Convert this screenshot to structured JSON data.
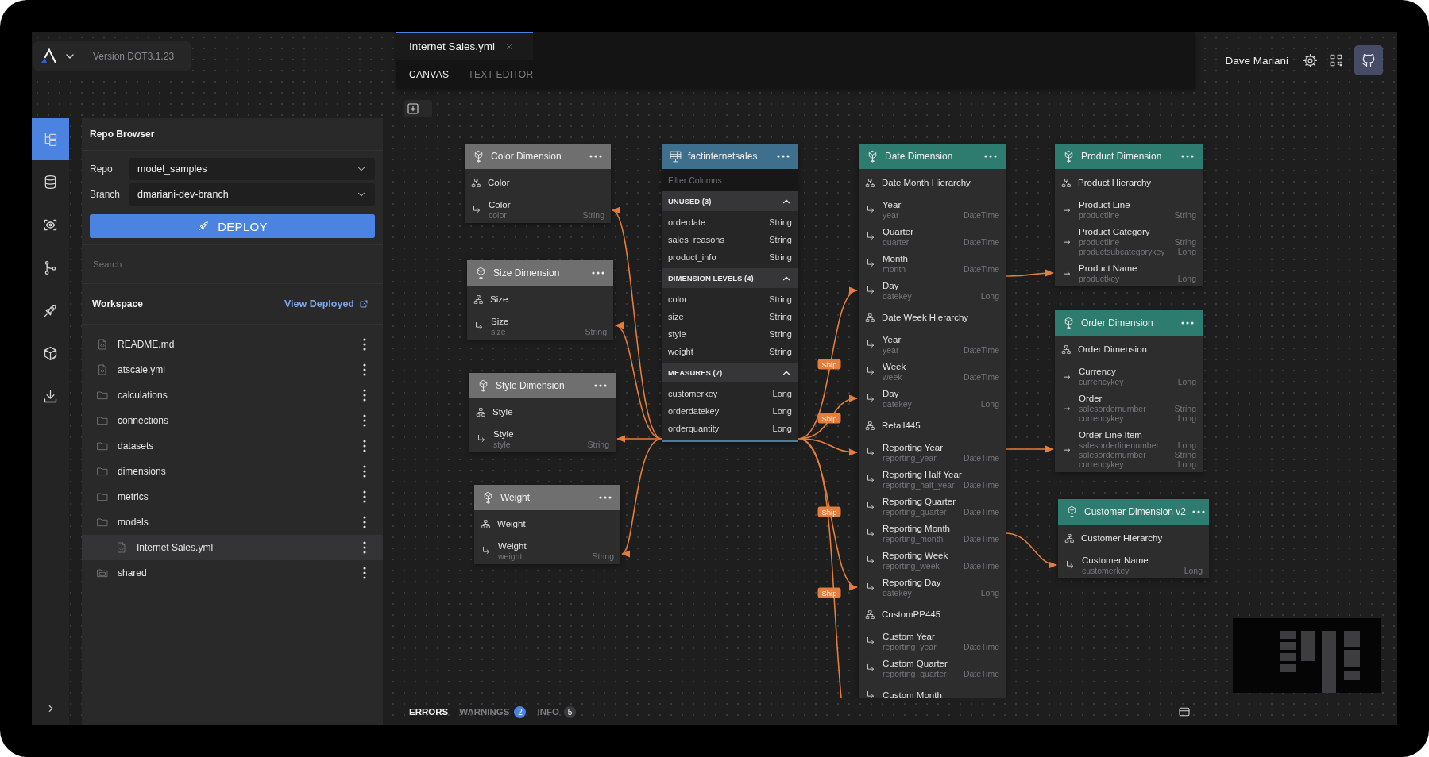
{
  "header": {
    "version": "Version DOT3.1.23"
  },
  "rail": [
    {
      "selected": true
    },
    {
      "selected": false
    },
    {
      "selected": false
    },
    {
      "selected": false
    },
    {
      "selected": false
    },
    {
      "selected": false
    },
    {
      "selected": false
    }
  ],
  "repo_browser": {
    "title": "Repo Browser",
    "fields": [
      {
        "label": "Repo",
        "value": "model_samples"
      },
      {
        "label": "Branch",
        "value": "dmariani-dev-branch"
      }
    ],
    "deploy_button": "DEPLOY",
    "search": {
      "placeholder": "Search"
    },
    "workspace": {
      "title": "Workspace",
      "link": "View Deployed"
    },
    "files": [
      {
        "name": "README.md",
        "kind": "file",
        "selected": false
      },
      {
        "name": "atscale.yml",
        "kind": "file",
        "selected": false
      },
      {
        "name": "calculations",
        "kind": "folder",
        "selected": false
      },
      {
        "name": "connections",
        "kind": "folder",
        "selected": false
      },
      {
        "name": "datasets",
        "kind": "folder",
        "selected": false
      },
      {
        "name": "dimensions",
        "kind": "folder",
        "selected": false
      },
      {
        "name": "metrics",
        "kind": "folder",
        "selected": false
      },
      {
        "name": "models",
        "kind": "folder",
        "selected": false,
        "children": [
          {
            "name": "Internet Sales.yml",
            "kind": "file",
            "selected": true
          }
        ]
      },
      {
        "name": "shared",
        "kind": "shared_folder",
        "selected": false
      }
    ]
  },
  "editor_tabs": [
    {
      "label": "Internet Sales.yml",
      "selected": true
    }
  ],
  "view_tabs": [
    {
      "label": "CANVAS",
      "selected": true
    },
    {
      "label": "TEXT EDITOR",
      "selected": false
    }
  ],
  "user": {
    "name": "Dave Mariani"
  },
  "canvas": {
    "nodes": [
      {
        "kind": "degenerate_dimension",
        "title": "Color Dimension",
        "rows": [
          {
            "kind": "hierarchy",
            "label": "Color"
          },
          {
            "kind": "level",
            "label": "Color",
            "columns": [
              {
                "name": "color",
                "type": "String"
              }
            ]
          }
        ]
      },
      {
        "kind": "degenerate_dimension",
        "title": "Size Dimension",
        "rows": [
          {
            "kind": "hierarchy",
            "label": "Size"
          },
          {
            "kind": "level",
            "label": "Size",
            "columns": [
              {
                "name": "size",
                "type": "String"
              }
            ]
          }
        ]
      },
      {
        "kind": "degenerate_dimension",
        "title": "Style Dimension",
        "rows": [
          {
            "kind": "hierarchy",
            "label": "Style"
          },
          {
            "kind": "level",
            "label": "Style",
            "columns": [
              {
                "name": "style",
                "type": "String"
              }
            ]
          }
        ]
      },
      {
        "kind": "degenerate_dimension",
        "title": "Weight",
        "rows": [
          {
            "kind": "hierarchy",
            "label": "Weight"
          },
          {
            "kind": "level",
            "label": "Weight",
            "columns": [
              {
                "name": "weight",
                "type": "String"
              }
            ]
          }
        ]
      },
      {
        "kind": "dataset",
        "title": "factinternetsales",
        "filter_placeholder": "Filter Columns",
        "sections": [
          {
            "title": "UNUSED (3)",
            "expanded": true,
            "columns": [
              {
                "name": "orderdate",
                "type": "String"
              },
              {
                "name": "sales_reasons",
                "type": "String"
              },
              {
                "name": "product_info",
                "type": "String"
              }
            ]
          },
          {
            "title": "DIMENSION LEVELS (4)",
            "expanded": true,
            "columns": [
              {
                "name": "color",
                "type": "String"
              },
              {
                "name": "size",
                "type": "String"
              },
              {
                "name": "style",
                "type": "String"
              },
              {
                "name": "weight",
                "type": "String"
              }
            ]
          },
          {
            "title": "MEASURES (7)",
            "expanded": true,
            "columns": [
              {
                "name": "customerkey",
                "type": "Long"
              },
              {
                "name": "orderdatekey",
                "type": "Long"
              },
              {
                "name": "orderquantity",
                "type": "Long"
              }
            ]
          }
        ]
      },
      {
        "kind": "dimension",
        "title": "Date Dimension",
        "rows": [
          {
            "kind": "hierarchy",
            "label": "Date Month Hierarchy"
          },
          {
            "kind": "level",
            "label": "Year",
            "columns": [
              {
                "name": "year",
                "type": "DateTime"
              }
            ]
          },
          {
            "kind": "level",
            "label": "Quarter",
            "columns": [
              {
                "name": "quarter",
                "type": "DateTime"
              }
            ]
          },
          {
            "kind": "level",
            "label": "Month",
            "columns": [
              {
                "name": "month",
                "type": "DateTime"
              }
            ]
          },
          {
            "kind": "level",
            "label": "Day",
            "columns": [
              {
                "name": "datekey",
                "type": "Long"
              }
            ]
          },
          {
            "kind": "hierarchy",
            "label": "Date Week Hierarchy"
          },
          {
            "kind": "level",
            "label": "Year",
            "columns": [
              {
                "name": "year",
                "type": "DateTime"
              }
            ]
          },
          {
            "kind": "level",
            "label": "Week",
            "columns": [
              {
                "name": "week",
                "type": "DateTime"
              }
            ]
          },
          {
            "kind": "level",
            "label": "Day",
            "columns": [
              {
                "name": "datekey",
                "type": "Long"
              }
            ]
          },
          {
            "kind": "hierarchy",
            "label": "Retail445"
          },
          {
            "kind": "level",
            "label": "Reporting Year",
            "columns": [
              {
                "name": "reporting_year",
                "type": "DateTime"
              }
            ]
          },
          {
            "kind": "level",
            "label": "Reporting Half Year",
            "columns": [
              {
                "name": "reporting_half_year",
                "type": "DateTime"
              }
            ]
          },
          {
            "kind": "level",
            "label": "Reporting Quarter",
            "columns": [
              {
                "name": "reporting_quarter",
                "type": "DateTime"
              }
            ]
          },
          {
            "kind": "level",
            "label": "Reporting Month",
            "columns": [
              {
                "name": "reporting_month",
                "type": "DateTime"
              }
            ]
          },
          {
            "kind": "level",
            "label": "Reporting Week",
            "columns": [
              {
                "name": "reporting_week",
                "type": "DateTime"
              }
            ]
          },
          {
            "kind": "level",
            "label": "Reporting Day",
            "columns": [
              {
                "name": "datekey",
                "type": "Long"
              }
            ]
          },
          {
            "kind": "hierarchy",
            "label": "CustomPP445"
          },
          {
            "kind": "level",
            "label": "Custom Year",
            "columns": [
              {
                "name": "reporting_year",
                "type": "DateTime"
              }
            ]
          },
          {
            "kind": "level",
            "label": "Custom Quarter",
            "columns": [
              {
                "name": "reporting_quarter",
                "type": "DateTime"
              }
            ]
          },
          {
            "kind": "level",
            "label": "Custom Month",
            "columns": []
          }
        ]
      },
      {
        "kind": "dimension",
        "title": "Product Dimension",
        "rows": [
          {
            "kind": "hierarchy",
            "label": "Product Hierarchy"
          },
          {
            "kind": "level",
            "label": "Product Line",
            "columns": [
              {
                "name": "productline",
                "type": "String"
              }
            ]
          },
          {
            "kind": "level",
            "label": "Product Category",
            "columns": [
              {
                "name": "productline",
                "type": "String"
              },
              {
                "name": "productsubcategorykey",
                "type": "Long"
              }
            ]
          },
          {
            "kind": "level",
            "label": "Product Name",
            "columns": [
              {
                "name": "productkey",
                "type": "Long"
              }
            ]
          }
        ]
      },
      {
        "kind": "dimension",
        "title": "Order Dimension",
        "rows": [
          {
            "kind": "hierarchy",
            "label": "Order Dimension"
          },
          {
            "kind": "level",
            "label": "Currency",
            "columns": [
              {
                "name": "currencykey",
                "type": "Long"
              }
            ]
          },
          {
            "kind": "level",
            "label": "Order",
            "columns": [
              {
                "name": "salesordernumber",
                "type": "String"
              },
              {
                "name": "currencykey",
                "type": "Long"
              }
            ]
          },
          {
            "kind": "level",
            "label": "Order Line Item",
            "columns": [
              {
                "name": "salesorderlinenumber",
                "type": "Long"
              },
              {
                "name": "salesordernumber",
                "type": "String"
              },
              {
                "name": "currencykey",
                "type": "Long"
              }
            ]
          }
        ]
      },
      {
        "kind": "dimension",
        "title": "Customer Dimension v2",
        "rows": [
          {
            "kind": "hierarchy",
            "label": "Customer Hierarchy"
          },
          {
            "kind": "level",
            "label": "Customer Name",
            "columns": [
              {
                "name": "customerkey",
                "type": "Long"
              }
            ]
          }
        ]
      }
    ],
    "relationship_labels": [
      "Ship",
      "Ship",
      "Ship",
      "Ship"
    ]
  },
  "status_bar": {
    "tabs": [
      {
        "label": "ERRORS",
        "selected": true
      },
      {
        "label": "WARNINGS",
        "selected": false,
        "count": "2",
        "color": "#4b84e0"
      },
      {
        "label": "INFO",
        "selected": false,
        "count": "5",
        "color": "#3b3b3d"
      }
    ]
  }
}
